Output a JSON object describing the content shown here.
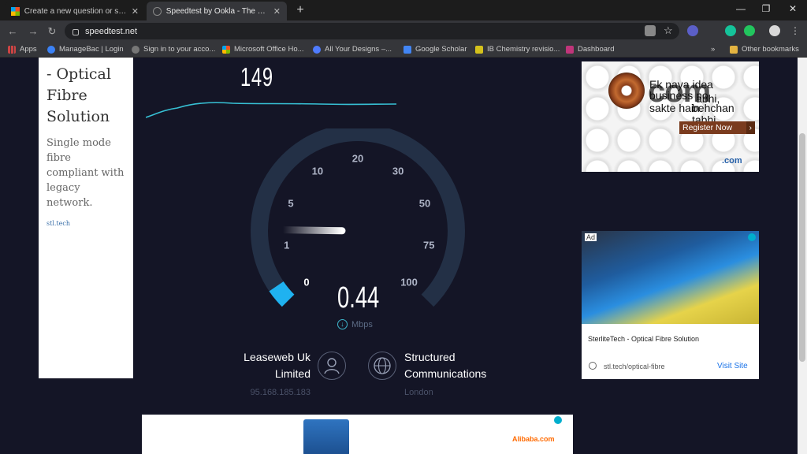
{
  "browser": {
    "tabs": [
      {
        "title": "Create a new question or start a",
        "active": false
      },
      {
        "title": "Speedtest by Ookla - The Globa",
        "active": true
      }
    ],
    "address": "speedtest.net",
    "bookmarks": [
      {
        "label": "Apps"
      },
      {
        "label": "ManageBac | Login"
      },
      {
        "label": "Sign in to your acco..."
      },
      {
        "label": "Microsoft Office Ho..."
      },
      {
        "label": "All Your Designs –..."
      },
      {
        "label": "Google Scholar"
      },
      {
        "label": "IB Chemistry revisio..."
      },
      {
        "label": "Dashboard"
      },
      {
        "label": "Other bookmarks"
      }
    ],
    "more": "»"
  },
  "left_ad": {
    "headline": "- Optical Fibre Solution",
    "body": "Single mode fibre compliant with legacy network.",
    "link": "stl.tech"
  },
  "speedtest": {
    "upload_value": "149",
    "speed_value": "0.44",
    "unit": "Mbps",
    "gauge_ticks": [
      "0",
      "1",
      "5",
      "10",
      "20",
      "30",
      "50",
      "75",
      "100"
    ],
    "gauge_fraction": 0.04,
    "isp": {
      "name": "Leaseweb Uk Limited",
      "ip": "95.168.185.183"
    },
    "server": {
      "name": "Structured Communications",
      "location": "London"
    }
  },
  "right_ad_top": {
    "brand": "com",
    "line1": "Ek naya idea",
    "line2": "abhi,",
    "line3": "business no",
    "line4": "behchan tabhi.",
    "line5": "sakte hain.",
    "cta": "Register Now",
    "domain": ".com"
  },
  "right_ad_bottom": {
    "badge": "Ad",
    "title": "SterliteTech - Optical Fibre Solution",
    "url": "stl.tech/optical-fibre",
    "cta": "Visit Site"
  },
  "bottom_ad": {
    "brand": "Alibaba.com"
  }
}
